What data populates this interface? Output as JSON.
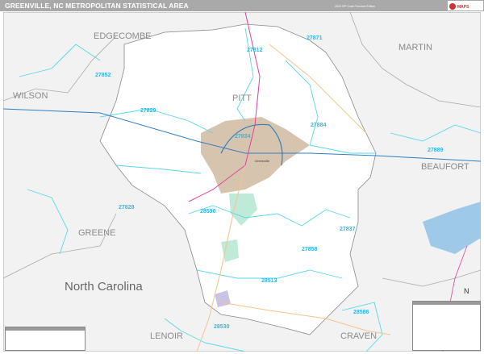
{
  "header": {
    "title": "GREENVILLE, NC METROPOLITAN STATISTICAL AREA",
    "edition": "2020 ZIP Code Premium Edition",
    "logo": "Market MAPS"
  },
  "map": {
    "state_label": "North Carolina",
    "counties": [
      "EDGECOMBE",
      "MARTIN",
      "WILSON",
      "PITT",
      "BEAUFORT",
      "GREENE",
      "LENOIR",
      "CRAVEN"
    ],
    "city_label": "Greenville",
    "zip_codes": [
      "27871",
      "27812",
      "27852",
      "27829",
      "27884",
      "27834",
      "27889",
      "27828",
      "28590",
      "27837",
      "27858",
      "28513",
      "28530",
      "28586"
    ],
    "colors": {
      "outside_area": "#f2f2f2",
      "msa_area": "#ffffff",
      "zip_boundary": "#55d8ee",
      "urban_area": "#d7c4ae",
      "highway_interstate": "#e040a0",
      "highway_us": "#2f7fc0",
      "state_road": "#f5c48a",
      "zip_label": "#2fb9e6"
    }
  },
  "compass": "N"
}
